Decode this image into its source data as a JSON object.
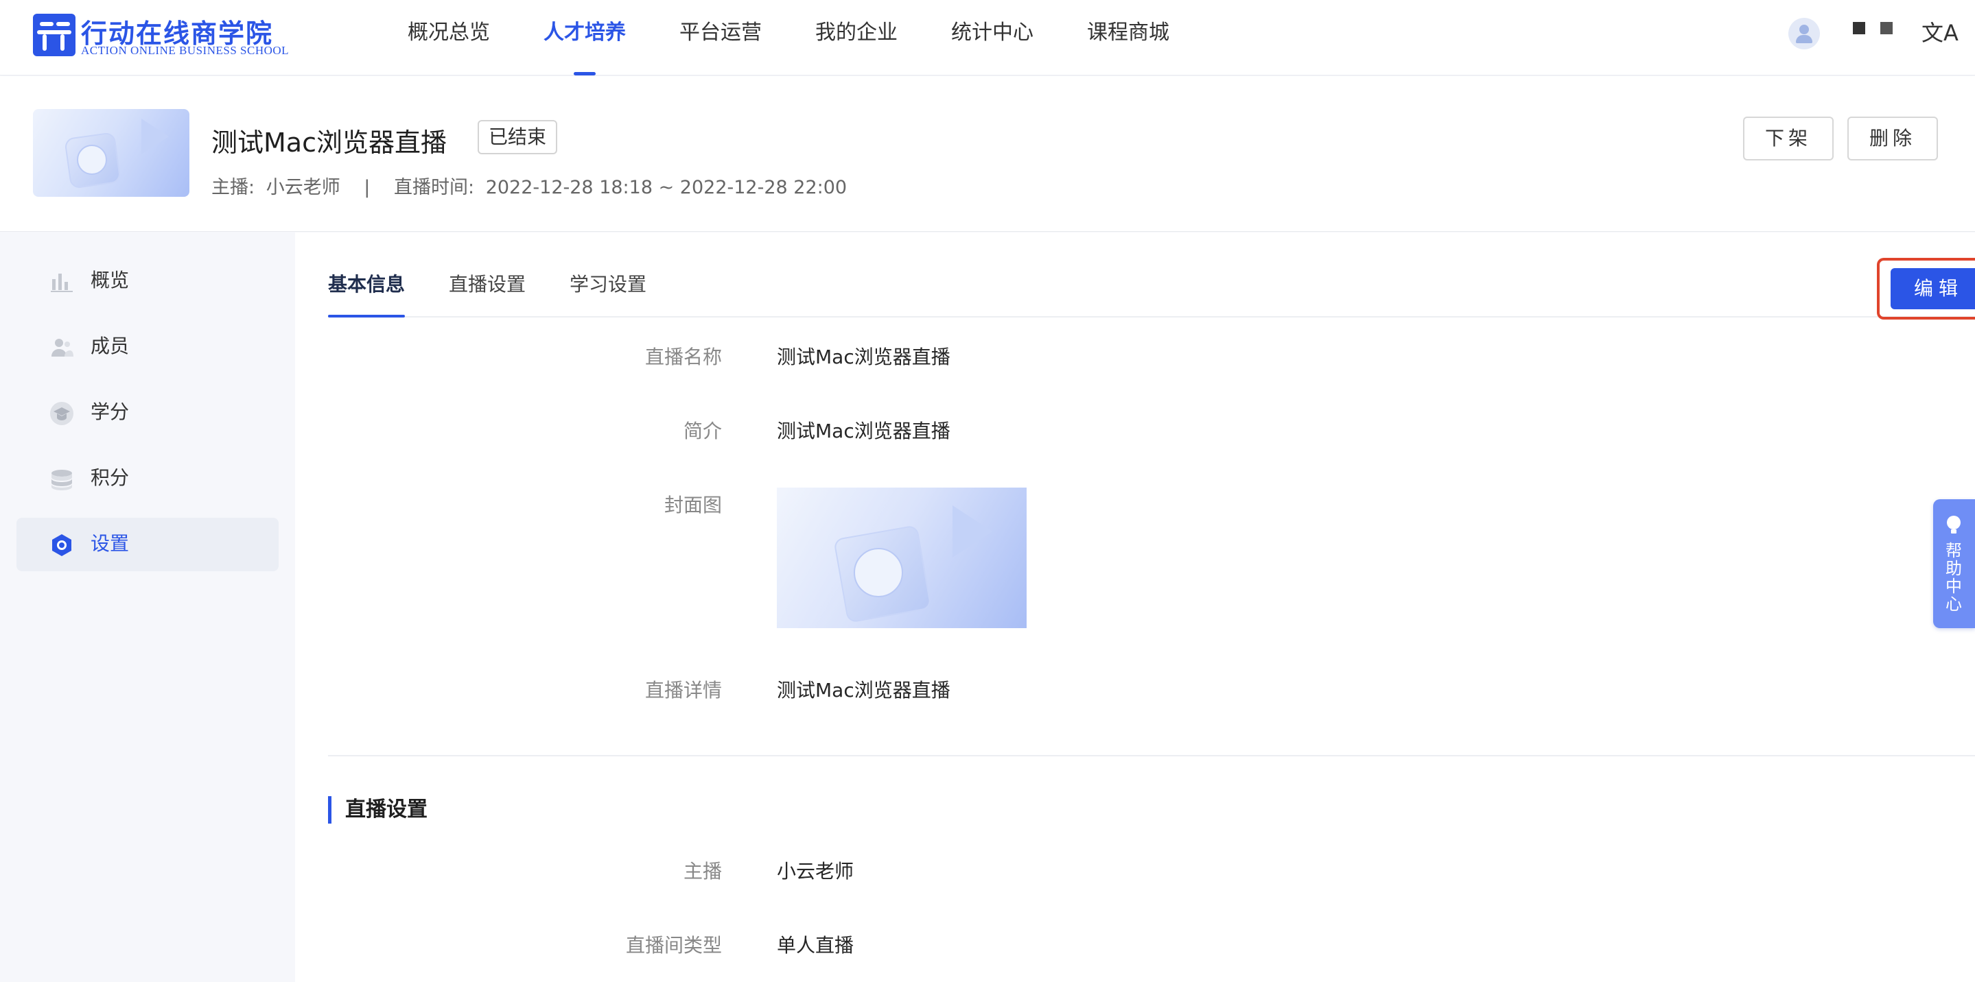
{
  "brand": {
    "name_cn": "行动在线商学院",
    "name_en": "ACTION ONLINE BUSINESS SCHOOL",
    "color": "#2b55e6"
  },
  "nav": {
    "items": [
      {
        "label": "概况总览",
        "active": false
      },
      {
        "label": "人才培养",
        "active": true
      },
      {
        "label": "平台运营",
        "active": false
      },
      {
        "label": "我的企业",
        "active": false
      },
      {
        "label": "统计中心",
        "active": false
      },
      {
        "label": "课程商城",
        "active": false
      }
    ],
    "lang_icon": "translate-icon",
    "lang_glyph": "文A"
  },
  "live": {
    "title": "测试Mac浏览器直播",
    "status": "已结束",
    "host_label": "主播:",
    "host": "小云老师",
    "separator": "|",
    "time_label": "直播时间:",
    "time_range": "2022-12-28 18:18 ~ 2022-12-28 22:00",
    "actions": {
      "unpublish": "下架",
      "delete": "删除"
    }
  },
  "sidebar": {
    "items": [
      {
        "label": "概览",
        "icon": "bar-chart-icon",
        "active": false
      },
      {
        "label": "成员",
        "icon": "users-icon",
        "active": false
      },
      {
        "label": "学分",
        "icon": "graduation-cap-icon",
        "active": false
      },
      {
        "label": "积分",
        "icon": "coins-icon",
        "active": false
      },
      {
        "label": "设置",
        "icon": "gear-icon",
        "active": true
      }
    ]
  },
  "tabs": {
    "items": [
      {
        "label": "基本信息",
        "active": true
      },
      {
        "label": "直播设置",
        "active": false
      },
      {
        "label": "学习设置",
        "active": false
      }
    ],
    "edit_label": "编辑"
  },
  "basic_info": {
    "name_label": "直播名称",
    "name_value": "测试Mac浏览器直播",
    "intro_label": "简介",
    "intro_value": "测试Mac浏览器直播",
    "cover_label": "封面图",
    "detail_label": "直播详情",
    "detail_value": "测试Mac浏览器直播"
  },
  "live_settings": {
    "section_title": "直播设置",
    "host_label": "主播",
    "host_value": "小云老师",
    "room_type_label": "直播间类型",
    "room_type_value": "单人直播"
  },
  "help": {
    "label": "帮助中心"
  },
  "colors": {
    "accent": "#2b55e6",
    "highlight_border": "#e0442c",
    "help_bg": "#6f8ef5"
  }
}
